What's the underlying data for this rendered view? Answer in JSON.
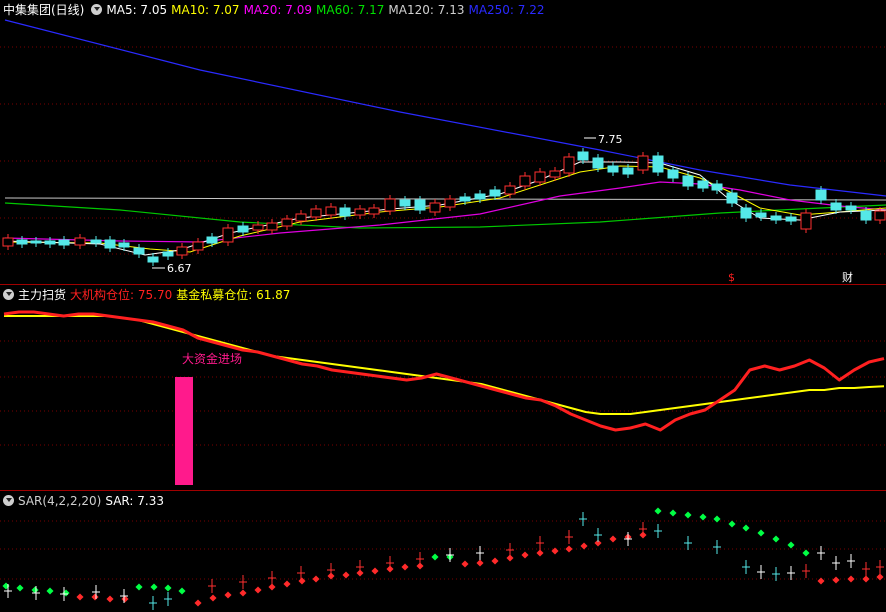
{
  "main": {
    "title": "中集集团(日线)",
    "indicators": [
      {
        "label": "MA5: 7.05",
        "color": "#ffffff"
      },
      {
        "label": "MA10: 7.07",
        "color": "#ffff00"
      },
      {
        "label": "MA20: 7.09",
        "color": "#ff00ff"
      },
      {
        "label": "MA60: 7.17",
        "color": "#00e000"
      },
      {
        "label": "MA120: 7.13",
        "color": "#d0d0d0"
      },
      {
        "label": "MA250: 7.22",
        "color": "#2a2aff"
      }
    ],
    "high_label": "7.75",
    "low_label": "6.67",
    "marker_dividend": "$",
    "marker_finance": "财"
  },
  "sub1": {
    "title": "主力扫货",
    "inst_label": "大机构仓位: 75.70",
    "fund_label": "基金私募仓位: 61.87",
    "signal_label": "大资金进场",
    "colors": {
      "inst": "#ff2020",
      "fund": "#ffff00",
      "signal": "#ff1a8c"
    }
  },
  "sub2": {
    "title": "SAR(4,2,2,20)",
    "value_label": "SAR: 7.33"
  },
  "chart_data": [
    {
      "type": "line",
      "title": "中集集团(日线)",
      "series": [
        {
          "name": "MA5",
          "values": [
            7.05
          ]
        },
        {
          "name": "MA10",
          "values": [
            7.07
          ]
        },
        {
          "name": "MA20",
          "values": [
            7.09
          ]
        },
        {
          "name": "MA60",
          "values": [
            7.17
          ]
        },
        {
          "name": "MA120",
          "values": [
            7.13
          ]
        },
        {
          "name": "MA250",
          "values": [
            7.22
          ]
        }
      ],
      "annotations": [
        "7.75",
        "6.67"
      ]
    },
    {
      "type": "line",
      "title": "主力扫货",
      "ylim": [
        0,
        100
      ],
      "series": [
        {
          "name": "大机构仓位",
          "values": [
            98,
            99,
            99,
            98,
            97,
            98,
            98,
            97,
            96,
            95,
            94,
            92,
            90,
            86,
            84,
            82,
            80,
            79,
            77,
            75,
            73,
            72,
            70,
            69,
            68,
            67,
            66,
            65,
            66,
            68,
            66,
            64,
            62,
            60,
            58,
            56,
            55,
            52,
            48,
            45,
            42,
            40,
            41,
            43,
            40,
            45,
            48,
            50,
            55,
            60,
            70,
            72,
            70,
            72,
            75,
            71,
            65,
            70,
            74,
            75.7
          ]
        },
        {
          "name": "基金私募仓位",
          "values": [
            97,
            97,
            97,
            97,
            97,
            97,
            97,
            97,
            96,
            95,
            93,
            91,
            89,
            87,
            85,
            83,
            81,
            79,
            77,
            76,
            75,
            74,
            73,
            72,
            71,
            70,
            69,
            68,
            67,
            66,
            65,
            64,
            63,
            61,
            59,
            57,
            55,
            53,
            51,
            49,
            48,
            48,
            48,
            49,
            50,
            51,
            52,
            53,
            54,
            55,
            56,
            57,
            58,
            59,
            60,
            60,
            61,
            61,
            61.5,
            61.87
          ]
        }
      ]
    },
    {
      "type": "scatter",
      "title": "SAR(4,2,2,20)",
      "series": [
        {
          "name": "SAR",
          "values": [
            7.33
          ]
        }
      ]
    }
  ]
}
